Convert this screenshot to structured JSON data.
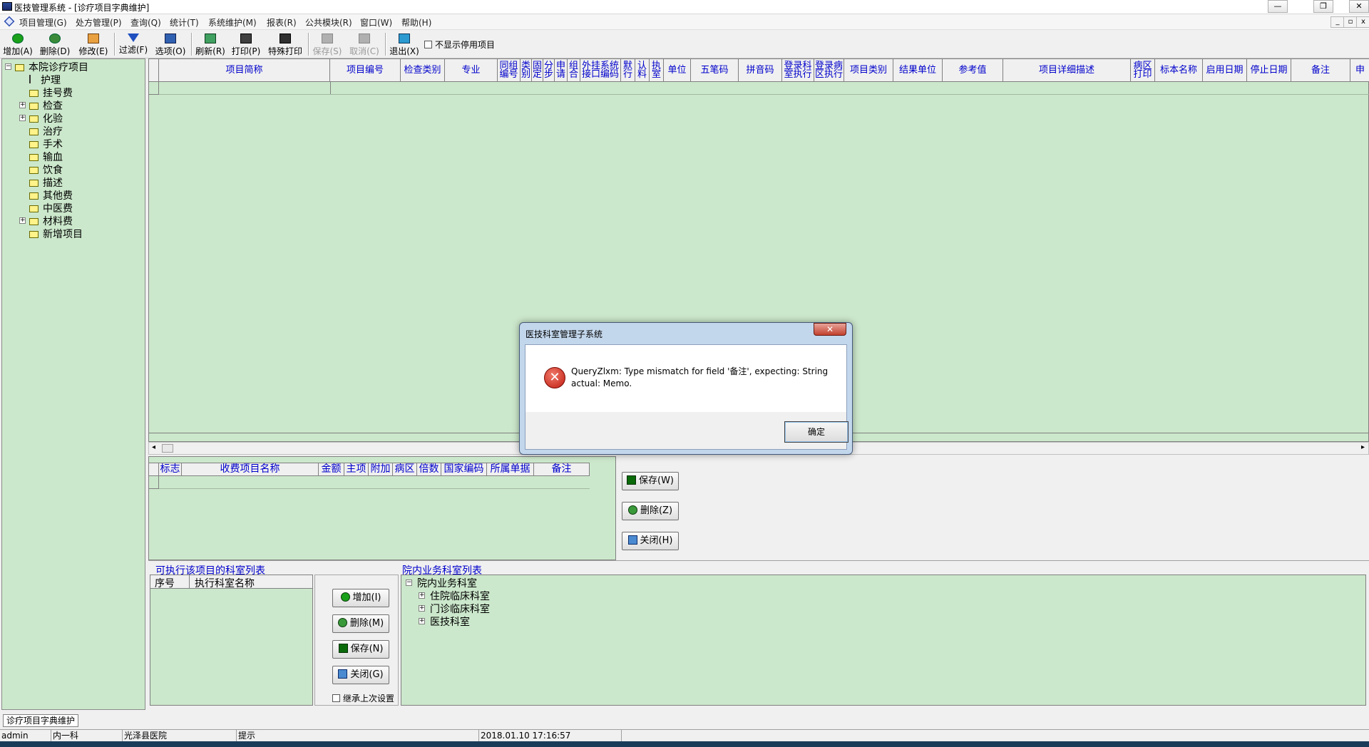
{
  "window": {
    "title": "医技管理系统 - [诊疗项目字典维护]"
  },
  "menu": [
    "项目管理(G)",
    "处方管理(P)",
    "查询(Q)",
    "统计(T)",
    "系统维护(M)",
    "报表(R)",
    "公共模块(R)",
    "窗口(W)",
    "帮助(H)"
  ],
  "toolbar": {
    "buttons": [
      {
        "label": "增加(A)",
        "icon": "add-icon",
        "enabled": true
      },
      {
        "label": "删除(D)",
        "icon": "delete-icon",
        "enabled": true
      },
      {
        "label": "修改(E)",
        "icon": "edit-icon",
        "enabled": true
      },
      {
        "label": "过滤(F)",
        "icon": "filter-icon",
        "enabled": true
      },
      {
        "label": "选项(O)",
        "icon": "options-icon",
        "enabled": true
      },
      {
        "label": "刷新(R)",
        "icon": "refresh-icon",
        "enabled": true
      },
      {
        "label": "打印(P)",
        "icon": "print-icon",
        "enabled": true
      },
      {
        "label": "特殊打印",
        "icon": "special-print-icon",
        "enabled": true
      },
      {
        "label": "保存(S)",
        "icon": "save-icon",
        "enabled": false
      },
      {
        "label": "取消(C)",
        "icon": "cancel-icon",
        "enabled": false
      },
      {
        "label": "退出(X)",
        "icon": "exit-icon",
        "enabled": true
      }
    ],
    "hide_disabled_label": "不显示停用项目"
  },
  "tree": {
    "root": "本院诊疗项目",
    "items": [
      "护理",
      "挂号费",
      "检查",
      "化验",
      "治疗",
      "手术",
      "输血",
      "饮食",
      "描述",
      "其他费",
      "中医费",
      "材料费",
      "新增项目"
    ]
  },
  "grid": {
    "columns": [
      "项目简称",
      "项目编号",
      "检查类别",
      "专业",
      "同组编号",
      "类别",
      "固定",
      "分步",
      "申请",
      "组合",
      "外挂系统接口编码",
      "默行",
      "认料",
      "执室",
      "单位",
      "五笔码",
      "拼音码",
      "登录科室执行",
      "登录病区执行",
      "项目类别",
      "结果单位",
      "参考值",
      "项目详细描述",
      "病区打印",
      "标本名称",
      "启用日期",
      "停止日期",
      "备注",
      "申"
    ]
  },
  "sub_grid": {
    "columns": [
      "标志",
      "收费项目名称",
      "金额",
      "主项",
      "附加",
      "病区",
      "倍数",
      "国家编码",
      "所属单据",
      "备注"
    ]
  },
  "sub_buttons": {
    "save": "保存(W)",
    "delete": "删除(Z)",
    "close": "关闭(H)"
  },
  "dept_section": {
    "title": "可执行该项目的科室列表",
    "col_no": "序号",
    "col_name": "执行科室名称",
    "add": "增加(I)",
    "delete": "删除(M)",
    "save": "保存(N)",
    "close": "关闭(G)",
    "inherit": "继承上次设置"
  },
  "hospital_section": {
    "title": "院内业务科室列表",
    "root": "院内业务科室",
    "items": [
      "住院临床科室",
      "门诊临床科室",
      "医技科室"
    ]
  },
  "tab": "诊疗项目字典维护",
  "status": {
    "user": "admin",
    "dept": "内一科",
    "hospital": "光泽县医院",
    "hint": "提示",
    "time": "2018.01.10 17:16:57"
  },
  "dialog": {
    "title": "医技科室管理子系统",
    "message": "QueryZlxm: Type mismatch for field '备注', expecting: String actual: Memo.",
    "ok": "确定"
  }
}
